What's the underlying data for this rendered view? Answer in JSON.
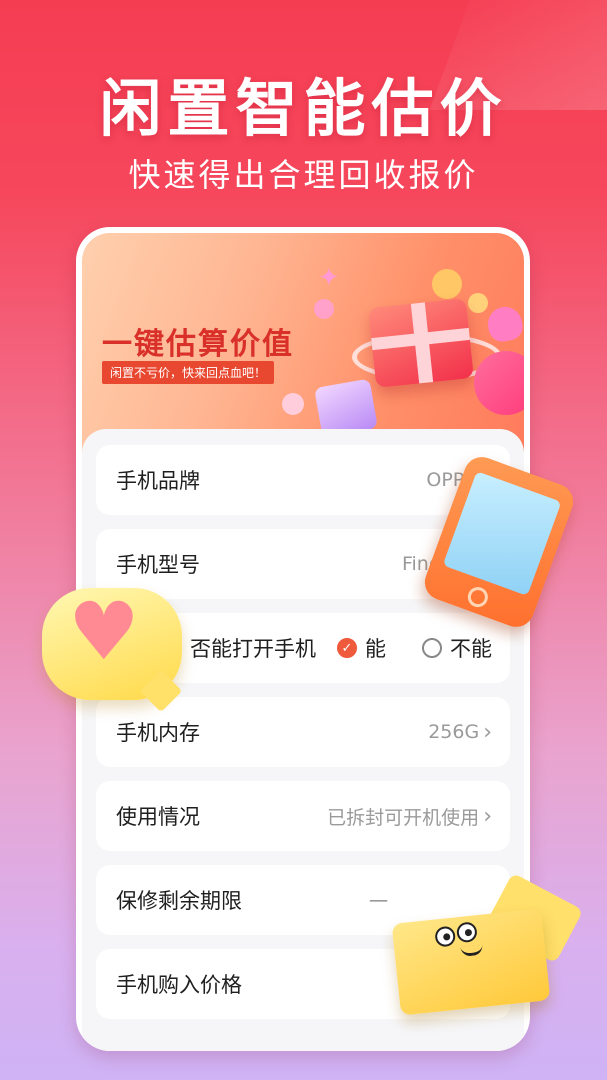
{
  "hero": {
    "title": "闲置智能估价",
    "subtitle": "快速得出合理回收报价"
  },
  "banner": {
    "title": "一键估算价值",
    "tagline": "闲置不亏价，快来回点血吧！"
  },
  "form": {
    "rows": [
      {
        "label": "手机品牌",
        "value": "OPPO"
      },
      {
        "label": "手机型号",
        "value": "Find X7 U"
      },
      {
        "label": "否能打开手机",
        "options": [
          "能",
          "不能"
        ],
        "selected": "能"
      },
      {
        "label": "手机内存",
        "value": "256G"
      },
      {
        "label": "使用情况",
        "value": "已拆封可开机使用"
      },
      {
        "label": "保修剩余期限",
        "value": "一"
      },
      {
        "label": "手机购入价格",
        "value": ""
      }
    ]
  },
  "icons": {
    "chevron": "chevron-right-icon",
    "checked": "check-circle-icon",
    "unchecked": "radio-empty-icon"
  },
  "colors": {
    "accent": "#f05a3c",
    "background_top": "#f53d52",
    "background_bottom": "#cfb3f5"
  }
}
